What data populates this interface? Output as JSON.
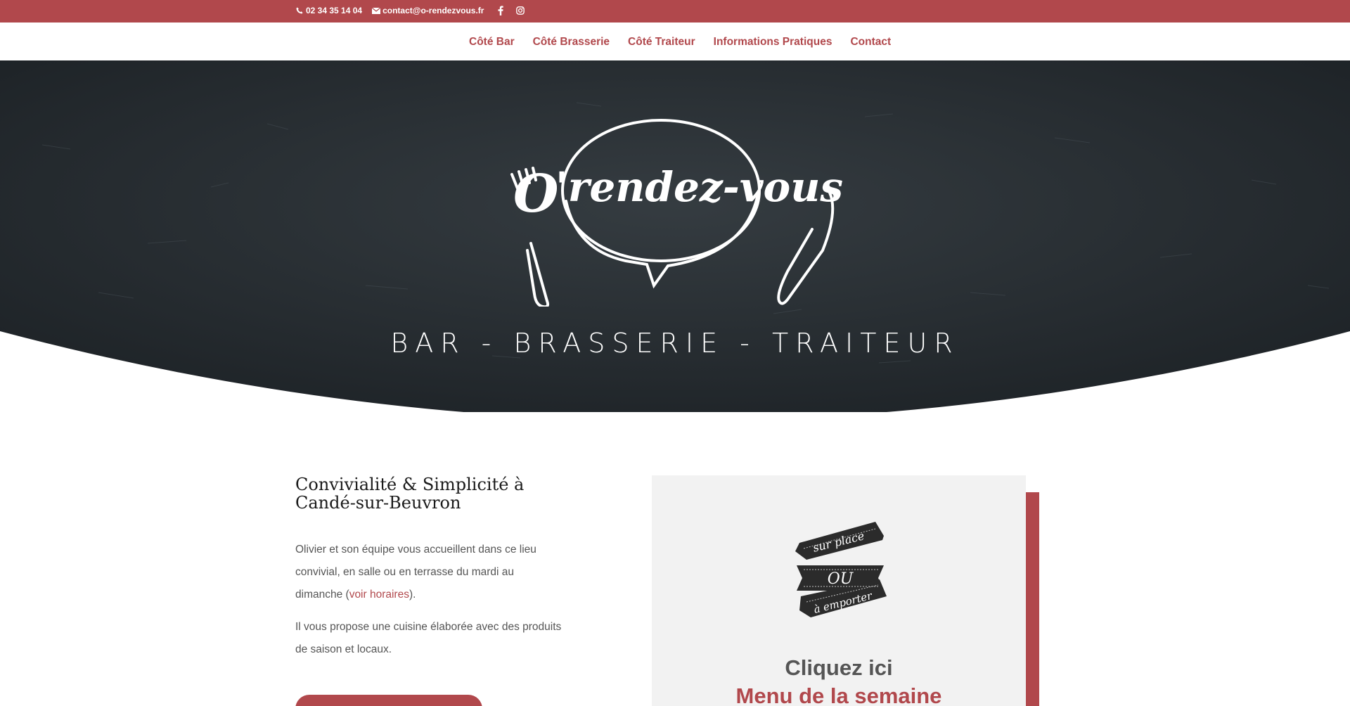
{
  "topbar": {
    "phone": "02 34 35 14 04",
    "email": "contact@o-rendezvous.fr",
    "social": [
      "facebook-icon",
      "instagram-icon"
    ]
  },
  "nav": {
    "items": [
      {
        "label": "Côté Bar"
      },
      {
        "label": "Côté Brasserie"
      },
      {
        "label": "Côté Traiteur"
      },
      {
        "label": "Informations Pratiques"
      },
      {
        "label": "Contact"
      }
    ]
  },
  "hero": {
    "logo_text": "O'rendez-vous",
    "tagline": "BAR - BRASSERIE - TRAITEUR"
  },
  "intro": {
    "title": "Convivialité & Simplicité à Candé-sur-Beuvron",
    "p1_before": "Olivier et son équipe vous accueillent dans ce lieu convivial, en salle ou en terrasse du mardi au dimanche (",
    "p1_link": "voir horaires",
    "p1_after": ").",
    "p2": "Il vous propose une cuisine élaborée avec des produits de saison et locaux."
  },
  "card": {
    "badge_top": "sur place",
    "badge_mid": "OU",
    "badge_bottom": "à emporter",
    "cta": "Cliquez ici",
    "menu": "Menu de la semaine"
  },
  "colors": {
    "brand": "#b1484c",
    "hero_bg": "#262c30",
    "card_bg": "#f2f2f2"
  }
}
